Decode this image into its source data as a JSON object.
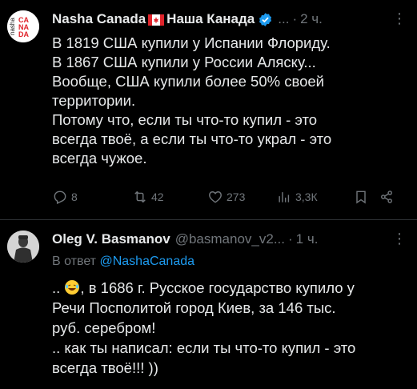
{
  "tweet1": {
    "avatar_text": "nasha CANADA",
    "name": "Nasha Canada",
    "name_suffix": "Наша Канада",
    "handle": "...",
    "dot": "·",
    "time": "2 ч.",
    "more": "⋮",
    "lines": [
      "В 1819 США купили у Испании Флориду.",
      "В 1867 США купили у России Аляску...",
      "Вообще, США купили более 50% своей",
      "территории.",
      "Потому что, если ты что-то купил - это",
      "всегда твоё, а если ты что-то украл - это",
      "всегда чужое."
    ],
    "actions": {
      "replies": "8",
      "retweets": "42",
      "likes": "273",
      "views": "3,3К"
    }
  },
  "tweet2": {
    "name": "Oleg V. Basmanov",
    "handle": "@basmanov_v2...",
    "dot": "·",
    "time": "1 ч.",
    "more": "⋮",
    "reply_label": "В ответ",
    "reply_handle": "@NashaCanada",
    "line1_prefix": "..",
    "line1_rest": ", в 1686 г. Русское государство купило у",
    "lines": [
      "Речи Посполитой город Киев, за 146 тыс.",
      "руб. серебром!",
      ".. как ты написал: если ты что-то купил - это",
      "всегда твоё!!! ))"
    ]
  },
  "colors": {
    "background": "#000000",
    "text": "#e7e9ea",
    "secondary": "#71767b",
    "link": "#1d9bf0",
    "verified": "#1d9bf0"
  }
}
